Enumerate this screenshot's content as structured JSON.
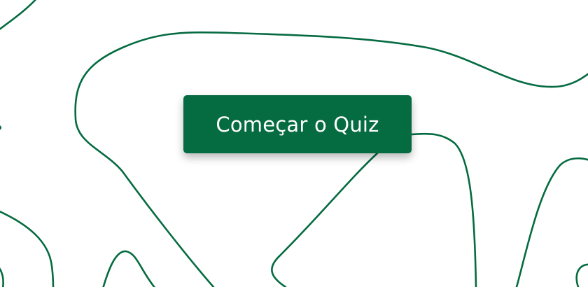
{
  "quiz_start": {
    "button_label": "Começar o Quiz"
  },
  "colors": {
    "brand_green": "#056b41",
    "background": "#ffffff"
  }
}
